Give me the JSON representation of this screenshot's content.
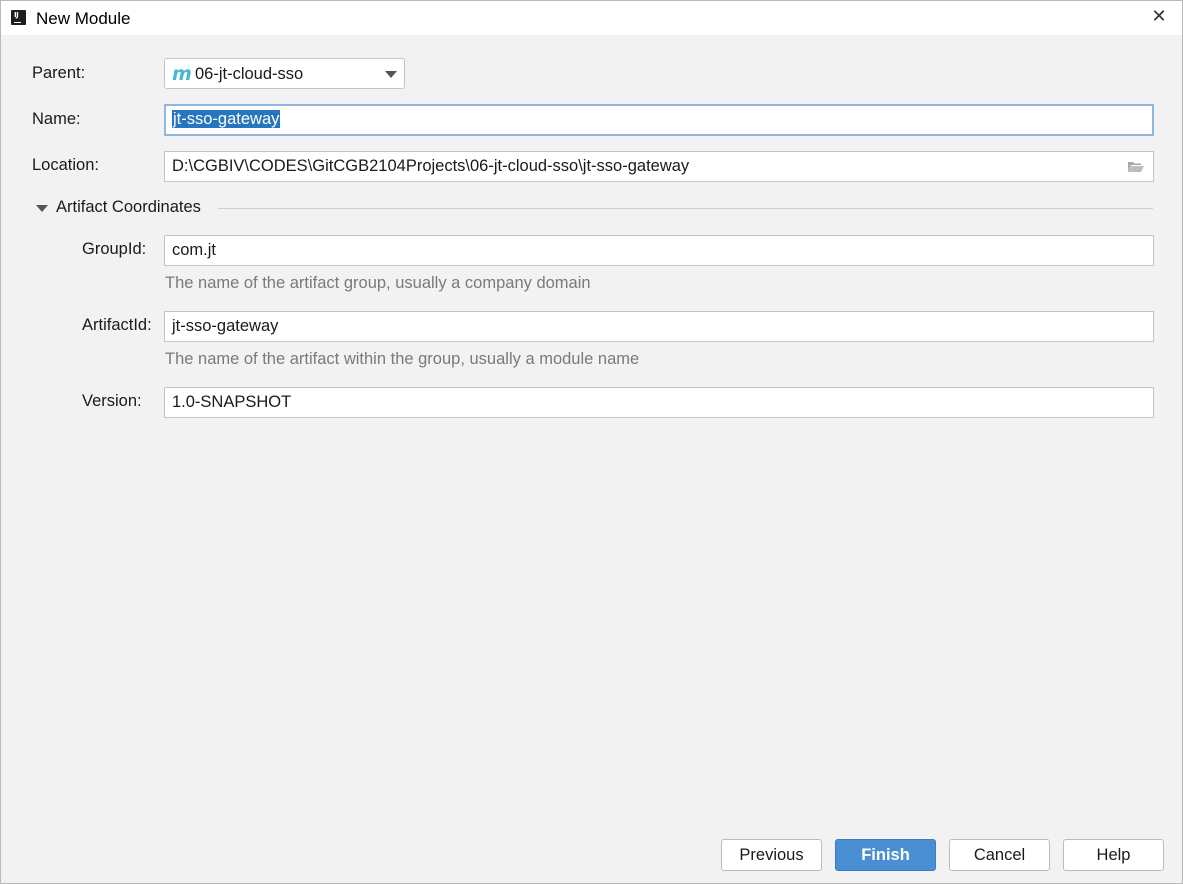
{
  "window": {
    "title": "New Module",
    "close_glyph": "✕"
  },
  "form": {
    "parent_label": "Parent:",
    "parent_icon_glyph": "m",
    "parent_value": "06-jt-cloud-sso",
    "name_label": "Name:",
    "name_value": "jt-sso-gateway",
    "location_label": "Location:",
    "location_value": "D:\\CGBIV\\CODES\\GitCGB2104Projects\\06-jt-cloud-sso\\jt-sso-gateway"
  },
  "artifact": {
    "section_title": "Artifact Coordinates",
    "groupid_label": "GroupId:",
    "groupid_value": "com.jt",
    "groupid_hint": "The name of the artifact group, usually a company domain",
    "artifactid_label": "ArtifactId:",
    "artifactid_value": "jt-sso-gateway",
    "artifactid_hint": "The name of the artifact within the group, usually a module name",
    "version_label": "Version:",
    "version_value": "1.0-SNAPSHOT"
  },
  "buttons": {
    "previous": "Previous",
    "finish": "Finish",
    "cancel": "Cancel",
    "help": "Help"
  },
  "colors": {
    "accent": "#4a8fd4",
    "selection": "#2675bf",
    "maven_icon": "#49b6d8"
  }
}
